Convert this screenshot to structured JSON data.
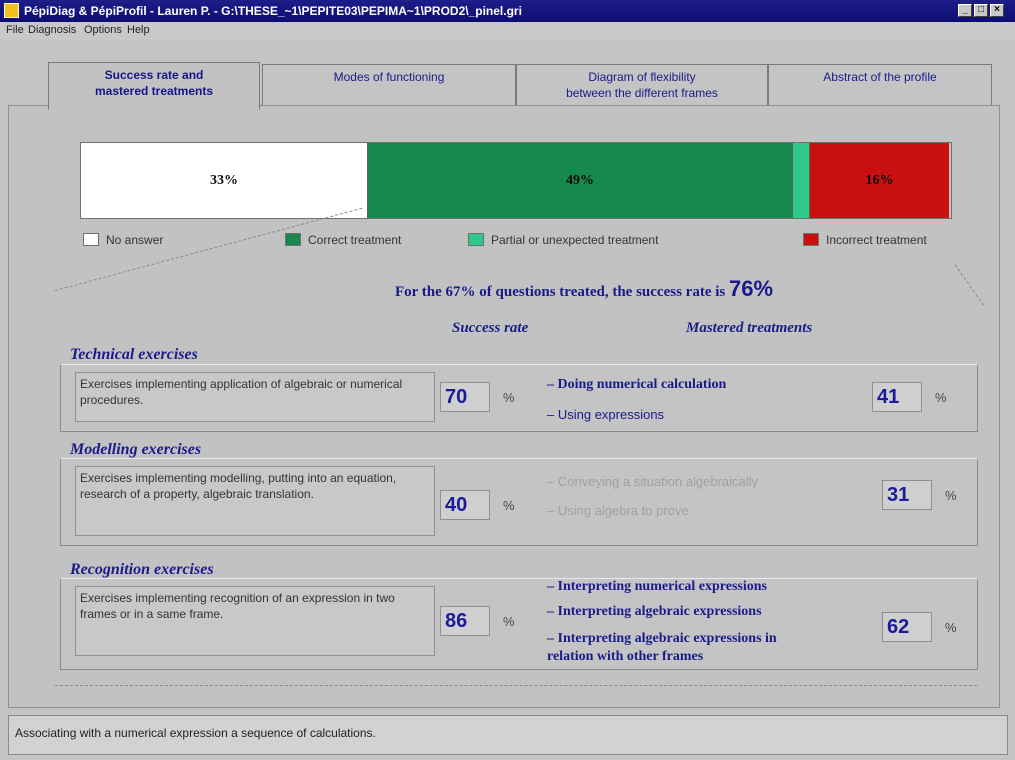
{
  "window": {
    "title": "PépiDiag & PépiProfil - Lauren P. - G:\\THESE_~1\\PEPITE03\\PEPIMA~1\\PROD2\\_pinel.gri"
  },
  "menu": [
    "File",
    "Diagnosis",
    "Options",
    "Help"
  ],
  "tabs": [
    {
      "label": "Success rate and\nmastered treatments",
      "active": true
    },
    {
      "label": "Modes of functioning",
      "active": false
    },
    {
      "label": "Diagram of flexibility\nbetween the different frames",
      "active": false
    },
    {
      "label": "Abstract of the profile",
      "active": false
    }
  ],
  "bar": {
    "segments": [
      {
        "name": "No answer",
        "value": 33,
        "label": "33%",
        "color": "#ffffff"
      },
      {
        "name": "Correct treatment",
        "value": 49,
        "label": "49%",
        "color": "#168a4c"
      },
      {
        "name": "Partial or unexpected treatment",
        "value": 2,
        "label": "",
        "color": "#2ec88a"
      },
      {
        "name": "Incorrect treatment",
        "value": 16,
        "label": "16%",
        "color": "#c81010"
      }
    ]
  },
  "legend": {
    "no_answer": "No answer",
    "correct": "Correct treatment",
    "partial": "Partial or unexpected treatment",
    "incorrect": "Incorrect treatment"
  },
  "summary": {
    "text": "For the 67% of questions treated, the success rate is",
    "value": "76%"
  },
  "columns": {
    "success_rate": "Success rate",
    "mastered": "Mastered treatments"
  },
  "sections": [
    {
      "title": "Technical exercises",
      "description": "Exercises implementing application of algebraic or numerical procedures.",
      "rate": "70",
      "rate_unit": "%",
      "treatments": [
        {
          "text": "– Doing numerical calculation",
          "style": "bold"
        },
        {
          "text": "– Using expressions",
          "style": "plain"
        }
      ],
      "mastered": "41",
      "mastered_unit": "%"
    },
    {
      "title": "Modelling exercises",
      "description": "Exercises implementing modelling, putting into an equation, research of a property, algebraic translation.",
      "rate": "40",
      "rate_unit": "%",
      "treatments": [
        {
          "text": "– Conveying a situation algebraically",
          "style": "grey"
        },
        {
          "text": "– Using algebra to prove",
          "style": "grey"
        }
      ],
      "mastered": "31",
      "mastered_unit": "%"
    },
    {
      "title": "Recognition exercises",
      "description": "Exercises implementing recognition of an expression in two frames or in a same frame.",
      "rate": "86",
      "rate_unit": "%",
      "treatments": [
        {
          "text": "– Interpreting numerical expressions",
          "style": "bold"
        },
        {
          "text": "– Interpreting algebraic expressions",
          "style": "bold"
        },
        {
          "text": "– Interpreting algebraic expressions in\nrelation with other frames",
          "style": "bold"
        }
      ],
      "mastered": "62",
      "mastered_unit": "%"
    }
  ],
  "status": {
    "text": "Associating with a numerical expression a sequence of calculations."
  }
}
